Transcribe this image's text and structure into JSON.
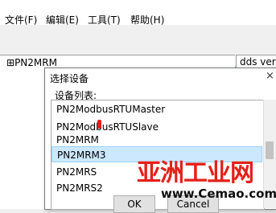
{
  "menubar": {
    "items": [
      "文件(F)",
      "编辑(E)",
      "工具(T)",
      "帮助(H)"
    ]
  },
  "toolbar": {
    "icons": [
      "new-icon",
      "open-icon",
      "save-icon",
      "add-node-icon",
      "delete-node-icon",
      "compile-icon",
      "upload-icon",
      "download-icon",
      "edit-icon",
      "settings-icon",
      "info-icon"
    ]
  },
  "tree": {
    "root_label": "PN2MRM",
    "expander": "⊞"
  },
  "rightpane": {
    "text": "dds vers"
  },
  "dialog": {
    "title": "选择设备",
    "close": "×",
    "list_label": "设备列表:",
    "items": [
      {
        "label": "PN2ModbusRTUMaster",
        "selected": false
      },
      {
        "label": "PN2ModbusRTUSlave",
        "selected": false
      },
      {
        "label": "PN2MRM",
        "selected": false
      },
      {
        "label": "PN2MRM3",
        "selected": true
      },
      {
        "label": "PN2MRS",
        "selected": false
      },
      {
        "label": "PN2MRS2",
        "selected": false
      }
    ],
    "ok_label": "OK",
    "cancel_label": "Cancel"
  },
  "watermark": {
    "main": "亚洲工业网",
    "sub": "www.Cemao.com"
  },
  "colors": {
    "selection": "#cce8ff",
    "watermark_red": "#e32119"
  }
}
